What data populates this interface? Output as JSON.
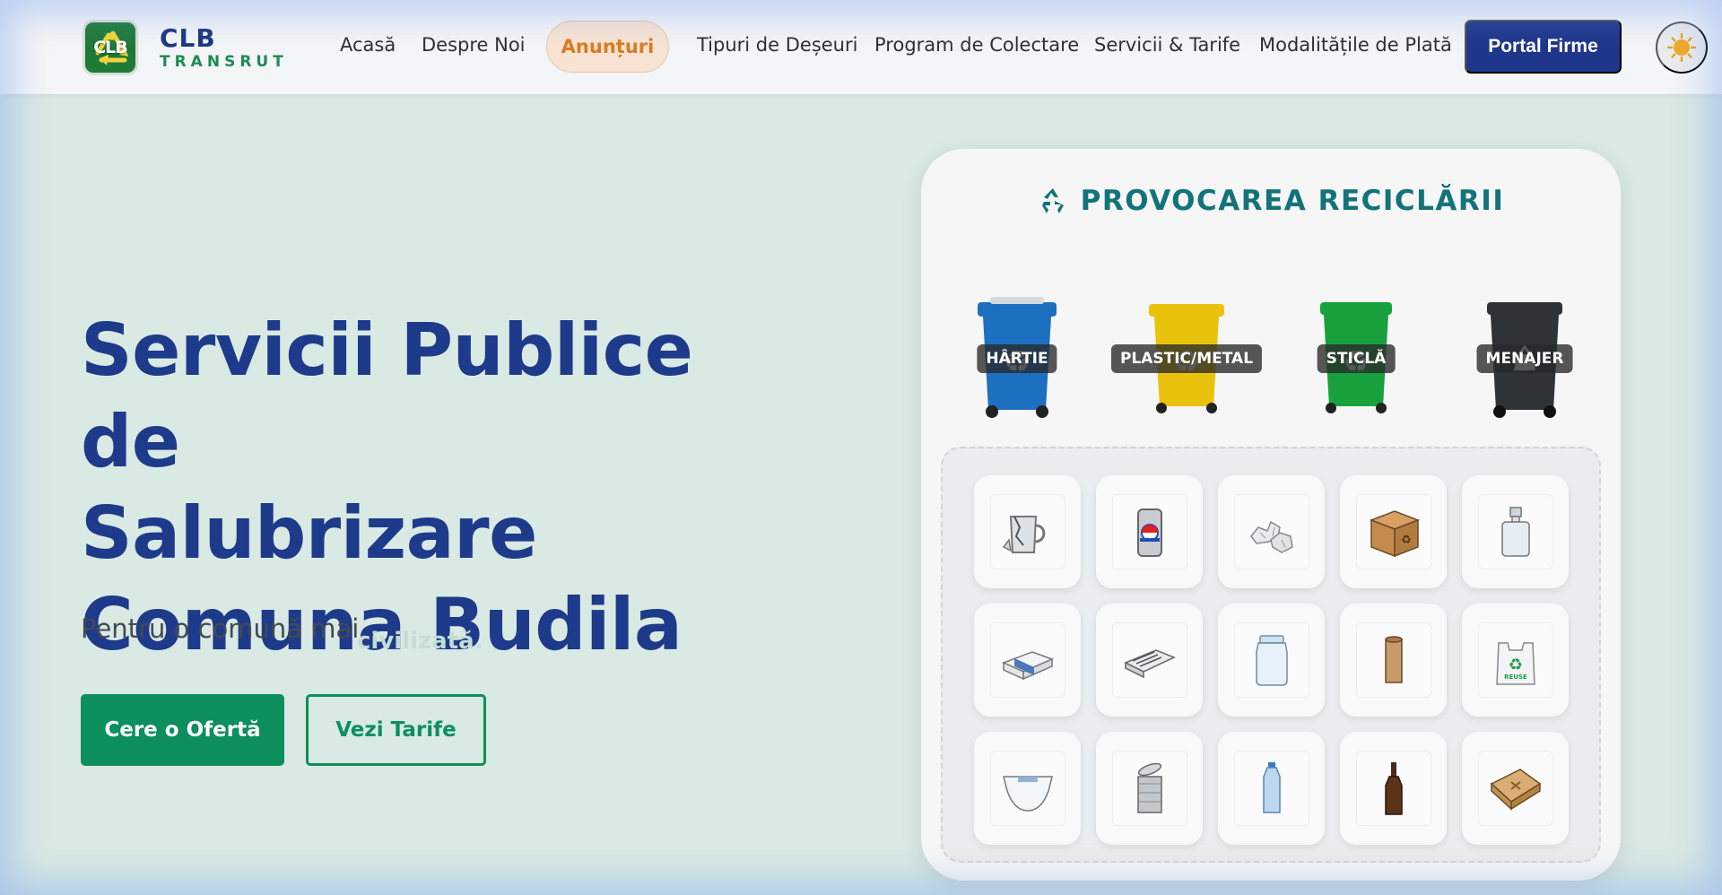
{
  "header": {
    "logo_letters": "CLB",
    "brand_name": "CLB",
    "brand_sub": "TRANSRUT",
    "nav": {
      "home": "Acasă",
      "about": "Despre Noi",
      "announcements": "Anunțuri",
      "waste_types": "Tipuri de Deșeuri",
      "schedule": "Program de Colectare",
      "services": "Servicii & Tarife",
      "payment": "Modalitățile de Plată"
    },
    "portal_button": "Portal Firme",
    "theme_icon": "sun-icon"
  },
  "hero": {
    "title_line1": "Servicii Publice de",
    "title_line2": "Salubrizare",
    "title_line3": "Comuna Budila",
    "subtitle": "Pentru o comună mai",
    "faded_word": "civilizată.",
    "cta_primary": "Cere o Ofertă",
    "cta_secondary": "Vezi Tarife"
  },
  "game": {
    "title": "PROVOCAREA RECICLĂRII",
    "bins": [
      {
        "label": "HÂRTIE",
        "color": "#1d6fc0"
      },
      {
        "label": "PLASTIC/METAL",
        "color": "#e9c20d"
      },
      {
        "label": "STICLĂ",
        "color": "#18a13d"
      },
      {
        "label": "MENAJER",
        "color": "#2f3336"
      }
    ],
    "items": [
      "broken-mug-icon",
      "soda-can-icon",
      "crumpled-paper-icon",
      "cardboard-box-icon",
      "perfume-bottle-icon",
      "paper-stack-icon",
      "newspaper-icon",
      "glass-jar-icon",
      "cardboard-tube-icon",
      "reuse-bag-icon",
      "diaper-icon",
      "tin-can-icon",
      "plastic-bottle-icon",
      "glass-bottle-icon",
      "pizza-box-icon"
    ],
    "reuse_bag_text": "REUSE"
  },
  "colors": {
    "brand_blue": "#1e3a8a",
    "brand_green": "#0c8f5c",
    "accent_orange": "#dc7a1f",
    "teal_title": "#12737a"
  }
}
